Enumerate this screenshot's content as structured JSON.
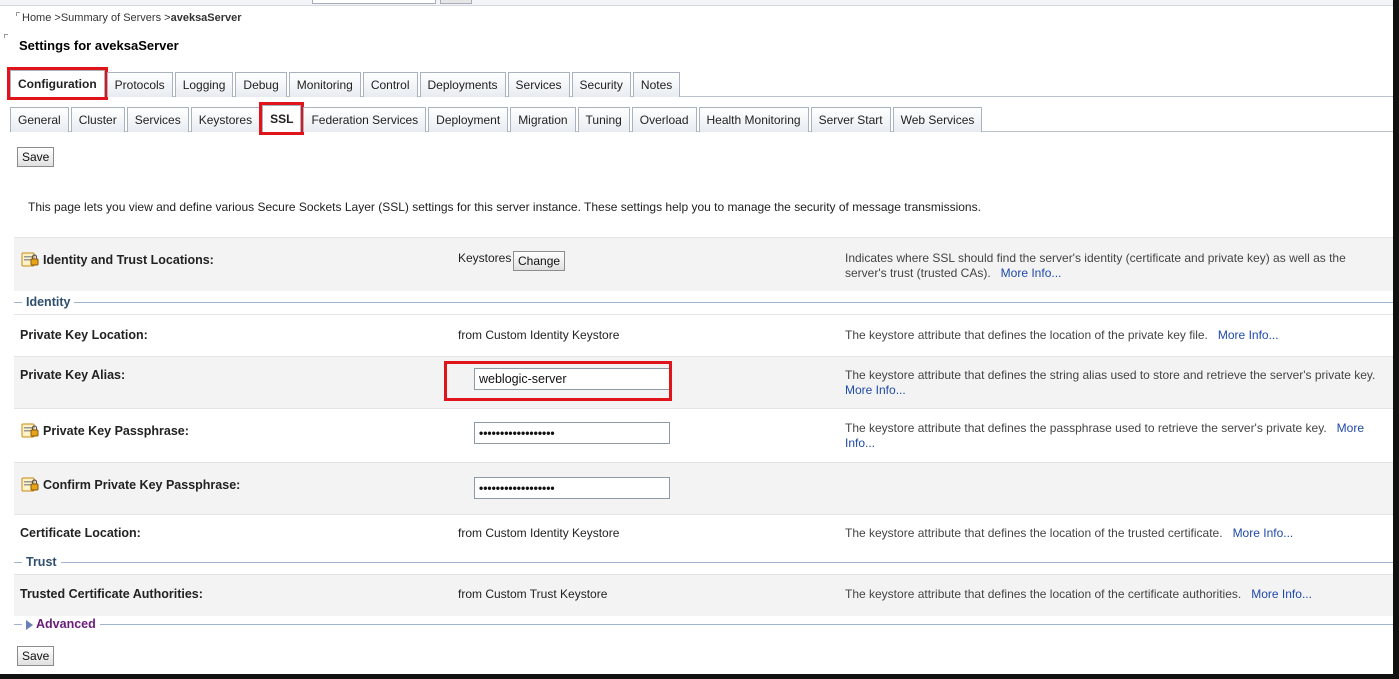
{
  "breadcrumb": {
    "home": "Home",
    "summary": "Summary of Servers",
    "current": "aveksaServer",
    "sep": ">"
  },
  "page_title": "Settings for aveksaServer",
  "tabs_level1": [
    "Configuration",
    "Protocols",
    "Logging",
    "Debug",
    "Monitoring",
    "Control",
    "Deployments",
    "Services",
    "Security",
    "Notes"
  ],
  "tabs_level2": [
    "General",
    "Cluster",
    "Services",
    "Keystores",
    "SSL",
    "Federation Services",
    "Deployment",
    "Migration",
    "Tuning",
    "Overload",
    "Health Monitoring",
    "Server Start",
    "Web Services"
  ],
  "active_tab_level1": "Configuration",
  "active_tab_level2": "SSL",
  "buttons": {
    "save": "Save",
    "change": "Change"
  },
  "intro": "This page lets you view and define various Secure Sockets Layer (SSL) settings for this server instance. These settings help you to manage the security of message transmissions.",
  "more_info": "More Info...",
  "identity_trust": {
    "label": "Identity and Trust Locations:",
    "value": "Keystores",
    "help": "Indicates where SSL should find the server's identity (certificate and private key) as well as the server's trust (trusted CAs)."
  },
  "sections": {
    "identity": "Identity",
    "trust": "Trust",
    "advanced": "Advanced"
  },
  "fields": {
    "pk_location": {
      "label": "Private Key Location:",
      "value": "from Custom Identity Keystore",
      "help": "The keystore attribute that defines the location of the private key file."
    },
    "pk_alias": {
      "label": "Private Key Alias:",
      "value": "weblogic-server",
      "help": "The keystore attribute that defines the string alias used to store and retrieve the server's private key."
    },
    "pk_pass": {
      "label": "Private Key Passphrase:",
      "value": "••••••••••••••••••",
      "help": "The keystore attribute that defines the passphrase used to retrieve the server's private key."
    },
    "pk_confirm": {
      "label": "Confirm Private Key Passphrase:",
      "value": "••••••••••••••••••"
    },
    "cert_location": {
      "label": "Certificate Location:",
      "value": "from Custom Identity Keystore",
      "help": "The keystore attribute that defines the location of the trusted certificate."
    },
    "trusted_ca": {
      "label": "Trusted Certificate Authorities:",
      "value": "from Custom Trust Keystore",
      "help": "The keystore attribute that defines the location of the certificate authorities."
    }
  },
  "icons": {
    "lock": "lock-edit-icon",
    "expand": "expand-triangle-icon"
  },
  "colors": {
    "highlight": "#e0141b",
    "link": "#1f4aa8"
  }
}
